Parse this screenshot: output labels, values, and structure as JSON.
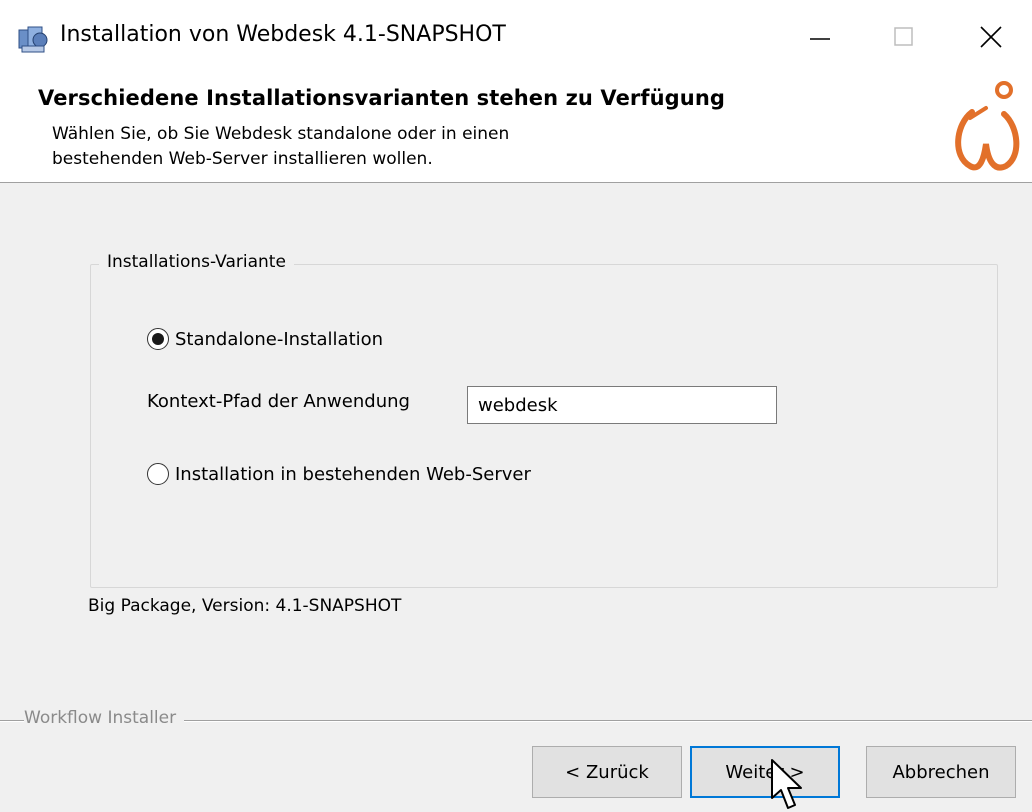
{
  "window": {
    "title": "Installation von Webdesk 4.1-SNAPSHOT",
    "icons": [
      "app-icon",
      "minimize-icon",
      "maximize-icon",
      "close-icon"
    ]
  },
  "header": {
    "title": "Verschiedene Installationsvarianten stehen zu Verfügung",
    "description_line1": "Wählen Sie, ob Sie Webdesk standalone oder in einen",
    "description_line2": "bestehenden Web-Server installieren wollen.",
    "logo_icon": "webdesk-logo-icon",
    "logo_color": "#e2702a"
  },
  "group": {
    "legend": "Installations-Variante",
    "options": [
      {
        "label": "Standalone-Installation",
        "selected": true
      },
      {
        "label": "Installation in bestehenden Web-Server",
        "selected": false
      }
    ],
    "context_label": "Kontext-Pfad der Anwendung",
    "context_value": "webdesk"
  },
  "version_text": "Big Package, Version: 4.1-SNAPSHOT",
  "branding_text": "Workflow Installer",
  "buttons": {
    "back": "< Zurück",
    "next": "Weiter >",
    "cancel": "Abbrechen"
  },
  "colors": {
    "focus_border": "#0078d7",
    "dialog_background": "#f0f0f0"
  }
}
